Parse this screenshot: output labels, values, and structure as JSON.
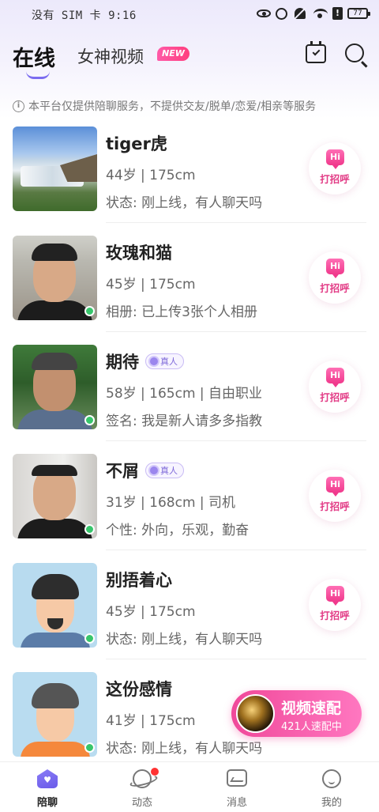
{
  "status_bar": {
    "carrier": "没有 SIM 卡 9:16",
    "battery": "77"
  },
  "header": {
    "tab_online": "在线",
    "tab_video": "女神视频",
    "new_badge": "NEW"
  },
  "notice": "本平台仅提供陪聊服务，不提供交友/脱单/恋爱/相亲等服务",
  "greet_label": "打招呼",
  "greet_hi": "Hi",
  "verified_label": "真人",
  "users": [
    {
      "name": "tiger虎",
      "info": "44岁 | 175cm",
      "detail": "状态: 刚上线，有人聊天吗",
      "verified": false,
      "online": false
    },
    {
      "name": "玫瑰和猫",
      "info": "45岁 | 175cm",
      "detail": "相册: 已上传3张个人相册",
      "verified": false,
      "online": true
    },
    {
      "name": "期待",
      "info": "58岁 | 165cm | 自由职业",
      "detail": "签名: 我是新人请多多指教",
      "verified": true,
      "online": true
    },
    {
      "name": "不屑",
      "info": "31岁 | 168cm | 司机",
      "detail": "个性: 外向，乐观，勤奋",
      "verified": true,
      "online": true
    },
    {
      "name": "别捂着心",
      "info": "45岁 | 175cm",
      "detail": "状态: 刚上线，有人聊天吗",
      "verified": false,
      "online": true
    },
    {
      "name": "这份感情",
      "info": "41岁 | 175cm",
      "detail": "状态: 刚上线，有人聊天吗",
      "verified": false,
      "online": true
    }
  ],
  "speed_match": {
    "title": "视频速配",
    "subtitle": "421人速配中"
  },
  "bottom_nav": [
    {
      "label": "陪聊",
      "active": true
    },
    {
      "label": "动态",
      "active": false
    },
    {
      "label": "消息",
      "active": false
    },
    {
      "label": "我的",
      "active": false
    }
  ],
  "colors": {
    "accent": "#7b6cf0",
    "greet_pink": "#e23c86",
    "online_green": "#37c66b"
  }
}
